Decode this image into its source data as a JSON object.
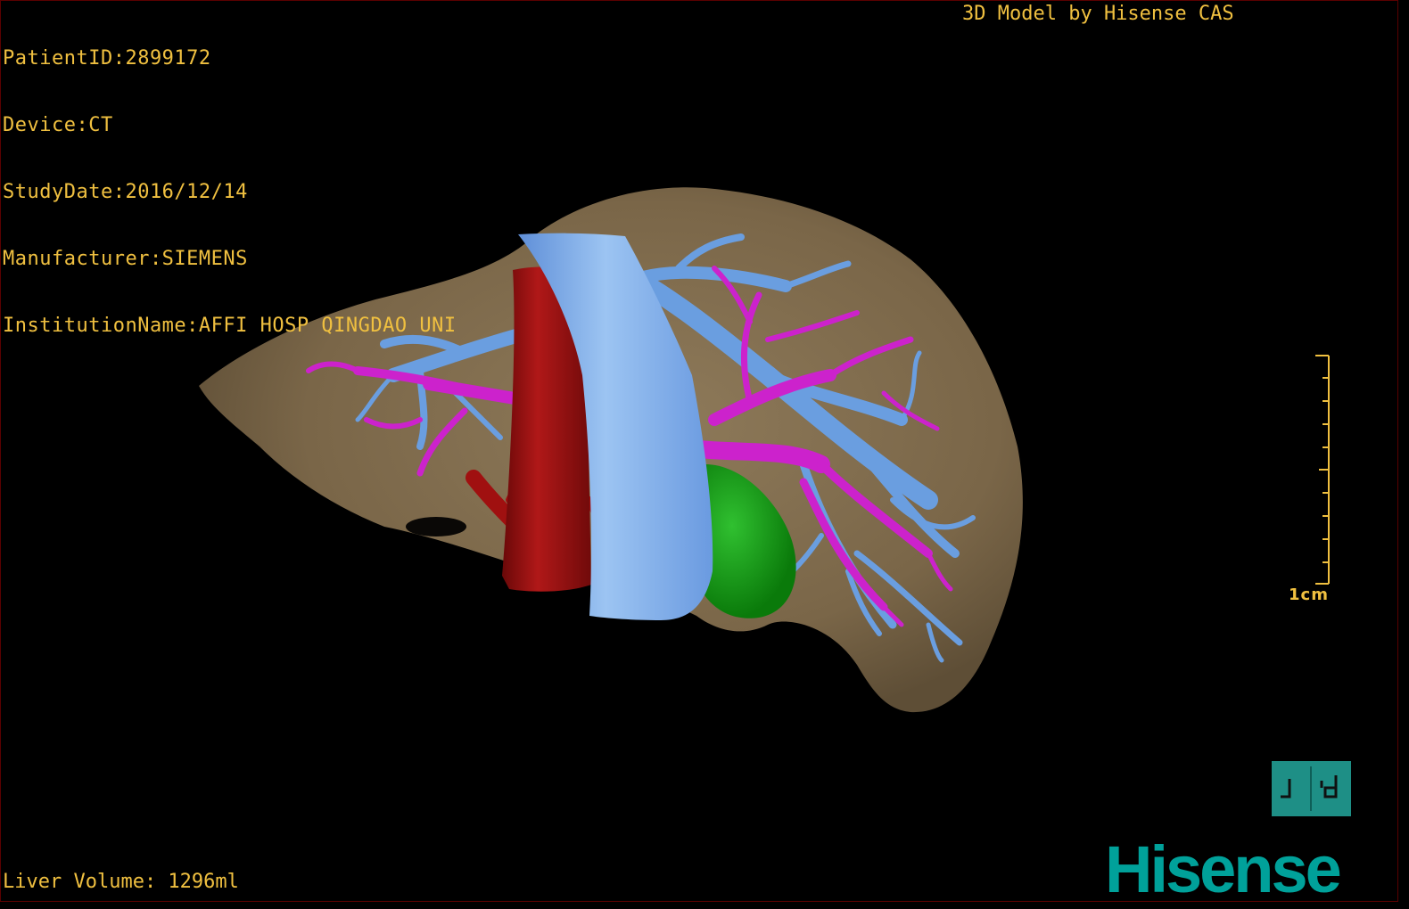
{
  "overlay": {
    "patient_info": [
      "PatientID:2899172",
      "Device:CT",
      "StudyDate:2016/12/14",
      "Manufacturer:SIEMENS",
      "InstitutionName:AFFI HOSP QINGDAO UNI"
    ],
    "model_credit": "3D Model by Hisense CAS",
    "volume_readout": "Liver Volume: 1296ml"
  },
  "scale": {
    "label": "1cm"
  },
  "view_cube": {
    "face_label": "ᒧ d"
  },
  "brand": {
    "logo_text": "Hisense"
  },
  "colors": {
    "overlay_text": "#f0c040",
    "liver": "#7d6a4e",
    "portal_vein": "#cc22cc",
    "hepatic_vein": "#6a9ee0",
    "ivc": "#7aaee8",
    "aorta": "#a01010",
    "gallbladder": "#18a018",
    "brand": "#00a19a"
  }
}
